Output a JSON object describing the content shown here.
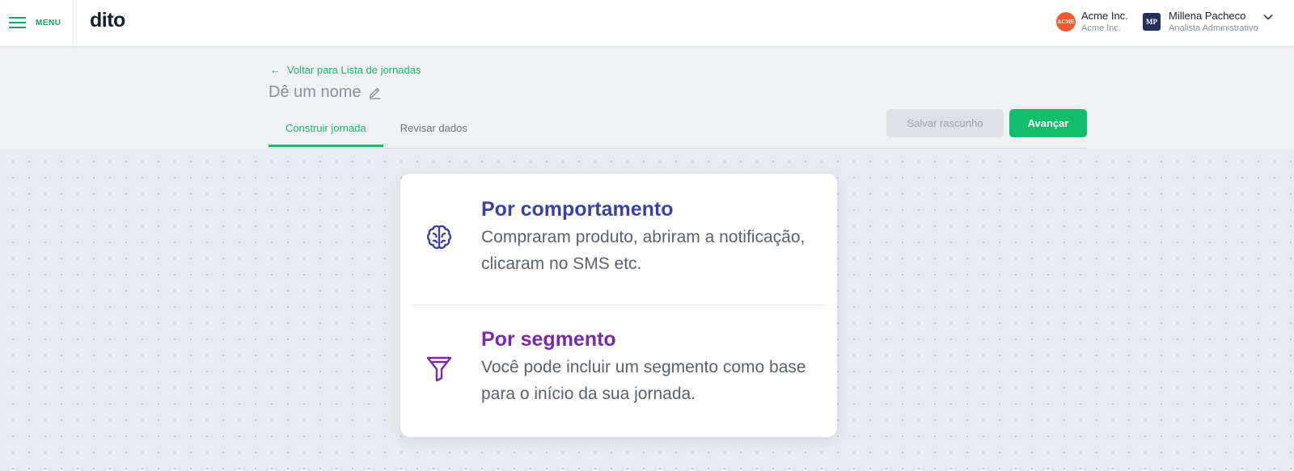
{
  "topbar": {
    "menu_label": "MENU",
    "logo": "dito",
    "account": {
      "badge": "ACME",
      "name": "Acme Inc.",
      "sub": "Acme Inc."
    },
    "user": {
      "initials": "MP",
      "name": "Millena Pacheco",
      "role": "Analista Administrativo"
    }
  },
  "header": {
    "back_link": "Voltar para Lista de jornadas",
    "journey_name": "Dê um nome",
    "tabs": [
      {
        "label": "Construir jornada",
        "active": true
      },
      {
        "label": "Revisar dados",
        "active": false
      }
    ],
    "save_draft_label": "Salvar rascunho",
    "next_label": "Avançar"
  },
  "options": [
    {
      "icon": "brain-icon",
      "title": "Por comportamento",
      "desc": "Compraram produto, abriram a notificação, clicaram no SMS etc."
    },
    {
      "icon": "funnel-icon",
      "title": "Por segmento",
      "desc": "Você pode incluir um segmento como base para o início da sua jornada."
    }
  ],
  "colors": {
    "brand_green": "#12be6a",
    "behavior_title": "#3c4399",
    "segment_title": "#7a2ba3",
    "acme_badge": "#ef5c34",
    "user_badge": "#23315a"
  }
}
